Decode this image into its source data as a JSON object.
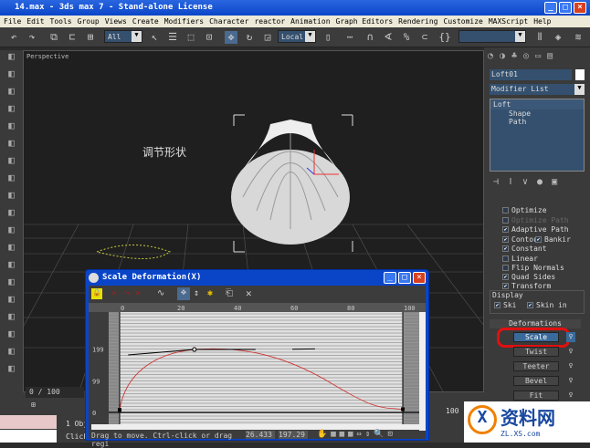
{
  "window": {
    "title": "14.max - 3ds max 7  - Stand-alone License"
  },
  "menu": [
    "File",
    "Edit",
    "Tools",
    "Group",
    "Views",
    "Create",
    "Modifiers",
    "Character",
    "reactor",
    "Animation",
    "Graph Editors",
    "Rendering",
    "Customize",
    "MAXScript",
    "Help"
  ],
  "toolbar": {
    "selection_filter": "All",
    "coord_system": "Local",
    "named_selection": ""
  },
  "viewport": {
    "label": "Perspective",
    "annotation": "调节形状",
    "annotation_color": "#cc2020"
  },
  "panel": {
    "object_name": "Loft01",
    "object_color": "#ffffff",
    "modifier_list": "Modifier List",
    "stack": [
      "Loft",
      "Shape",
      "Path"
    ],
    "options": [
      {
        "label": "Optimize",
        "checked": false
      },
      {
        "label": "Optimize Path",
        "checked": false,
        "disabled": true
      },
      {
        "label": "Adaptive Path",
        "checked": true
      },
      {
        "label": "Contou",
        "checked": true
      },
      {
        "label": "Bankir",
        "checked": true
      },
      {
        "label": "Constant",
        "checked": true
      },
      {
        "label": "Linear",
        "checked": false
      },
      {
        "label": "Flip Normals",
        "checked": false
      },
      {
        "label": "Quad Sides",
        "checked": true
      },
      {
        "label": "Transform",
        "checked": true
      }
    ],
    "display": {
      "title": "Display",
      "skin": "Ski",
      "skin_in": "Skin in"
    },
    "deformations": {
      "title": "Deformations",
      "buttons": [
        "Scale",
        "Twist",
        "Teeter",
        "Bevel",
        "Fit"
      ],
      "active": "Scale"
    }
  },
  "dialog": {
    "title": "Scale Deformation(X)",
    "x_ticks": [
      "0",
      "20",
      "40",
      "60",
      "80",
      "100"
    ],
    "y_ticks": [
      "199",
      "99",
      "0"
    ],
    "curve_points": [
      {
        "x": 0,
        "y": 8
      },
      {
        "x": 26.4,
        "y": 197
      },
      {
        "x": 100,
        "y": 10
      }
    ],
    "status": "Drag to move. Ctrl-click or drag regi",
    "readout_x": "26.433",
    "readout_y": "197.29"
  },
  "timeline": {
    "frame": "0 / 100",
    "status1": "1 Obj",
    "status2": "Click",
    "spinner": "100"
  },
  "watermark": {
    "text": "资料网",
    "url_text": "ZL.XS.com"
  }
}
